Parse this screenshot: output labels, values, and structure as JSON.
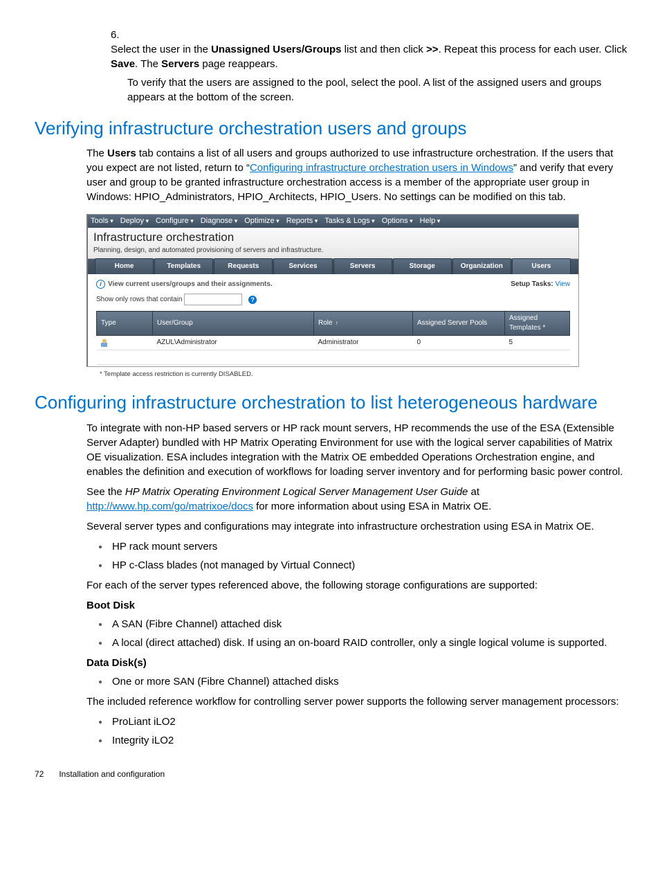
{
  "step6": {
    "num": "6.",
    "text_parts": {
      "p1": "Select the user in the ",
      "b1": "Unassigned Users/Groups",
      "p2": " list and then click ",
      "b2": ">>",
      "p3": ". Repeat this process for each user. Click ",
      "b3": "Save",
      "p4": ". The ",
      "b4": "Servers",
      "p5": " page reappears."
    },
    "sub": "To verify that the users are assigned to the pool, select the pool. A list of the assigned users and groups appears at the bottom of the screen."
  },
  "sec1": {
    "title": "Verifying infrastructure orchestration users and groups",
    "para": {
      "p1": "The ",
      "b1": "Users",
      "p2": " tab contains a list of all users and groups authorized to use infrastructure orchestration. If the users that you expect are not listed, return to “",
      "link": "Configuring infrastructure orchestration users in Windows",
      "p3": "” and verify that every user and group to be granted infrastructure orchestration access is a member of the appropriate user group in Windows: HPIO_Administrators, HPIO_Architects, HPIO_Users. No settings can be modified on this tab."
    }
  },
  "shot": {
    "menus": [
      "Tools",
      "Deploy",
      "Configure",
      "Diagnose",
      "Optimize",
      "Reports",
      "Tasks & Logs",
      "Options",
      "Help"
    ],
    "title": "Infrastructure orchestration",
    "subtitle": "Planning, design, and automated provisioning of servers and infrastructure.",
    "tabs": [
      "Home",
      "Templates",
      "Requests",
      "Services",
      "Servers",
      "Storage",
      "Organization",
      "Users"
    ],
    "info": "View current users/groups and their assignments.",
    "setup_label": "Setup Tasks:",
    "setup_view": "View",
    "filter_label": "Show only rows that contain",
    "filter_value": "",
    "columns": [
      "Type",
      "User/Group",
      "Role",
      "Assigned Server Pools",
      "Assigned Templates *"
    ],
    "row": {
      "user_group": "AZUL\\Administrator",
      "role": "Administrator",
      "pools": "0",
      "templates": "5"
    },
    "footnote": "* Template access restriction is currently DISABLED."
  },
  "sec2": {
    "title": "Configuring infrastructure orchestration to list heterogeneous hardware",
    "para1": "To integrate with non-HP based servers or HP rack mount servers, HP recommends the use of the ESA (Extensible Server Adapter) bundled with HP Matrix Operating Environment for use with the logical server capabilities of Matrix OE visualization. ESA includes integration with the Matrix OE embedded Operations Orchestration engine, and enables the definition and execution of workflows for loading server inventory and for performing basic power control.",
    "para2a": "See the ",
    "para2i": "HP Matrix Operating Environment Logical Server Management User Guide",
    "para2b": " at ",
    "link2": "http://www.hp.com/go/matrixoe/docs",
    "para2c": " for more information about using ESA in Matrix OE.",
    "para3": "Several server types and configurations may integrate into infrastructure orchestration using ESA in Matrix OE.",
    "list1": [
      "HP rack mount servers",
      "HP c-Class blades (not managed by Virtual Connect)"
    ],
    "para4": "For each of the server types referenced above, the following storage configurations are supported:",
    "sub1": "Boot Disk",
    "list2": [
      "A SAN (Fibre Channel) attached disk",
      "A local (direct attached) disk. If using an on-board RAID controller, only a single logical volume is supported."
    ],
    "sub2": "Data Disk(s)",
    "list3": [
      "One or more SAN (Fibre Channel) attached disks"
    ],
    "para5": "The included reference workflow for controlling server power supports the following server management processors:",
    "list4": [
      "ProLiant iLO2",
      "Integrity iLO2"
    ]
  },
  "footer": {
    "page": "72",
    "title": "Installation and configuration"
  }
}
